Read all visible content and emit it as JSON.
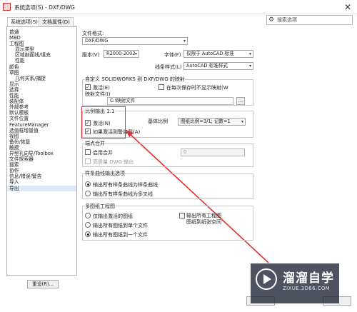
{
  "window": {
    "title": "系统选项(S) - DXF/DWG",
    "close": "✕"
  },
  "tabs": [
    {
      "label": "系统选项(S)"
    },
    {
      "label": "文档属性(D)"
    }
  ],
  "search": {
    "placeholder": "搜索选项"
  },
  "tree": {
    "items": [
      "普通",
      "MBD",
      "工程图",
      "显示类型",
      "区域剖面线/填充",
      "性能",
      "颜色",
      "草图",
      "几何关系/捕捉",
      "显示",
      "选择",
      "性能",
      "装配体",
      "外部参考",
      "默认模板",
      "文件位置",
      "FeatureManager",
      "选值框增量值",
      "视图",
      "备份/恢复",
      "触摸",
      "异型孔向导/Toolbox",
      "文件探索器",
      "搜索",
      "协作",
      "信息/错误/警告",
      "导入",
      "导出"
    ]
  },
  "reset_button": "重设(R)...",
  "file_format": {
    "label": "文件格式:",
    "value": "DXF/DWG"
  },
  "version": {
    "label": "版本(V)",
    "value": "R2000-2002"
  },
  "font": {
    "label": "字体(F)",
    "value": "仅限于 AutoCAD 标准"
  },
  "line_style": {
    "label": "线条样式(L)",
    "value": "AutoCAD 标准样式"
  },
  "custom_map": {
    "title": "自定义 SOLIDWORKS 到 DXF/DWG 的映射",
    "enable": "激活(E)",
    "no_show": "在每次保存时不显示映射(W",
    "map_file_label": "映射文件(I)",
    "map_file_value": "C:\\映射文件",
    "browse": "..."
  },
  "scale": {
    "title": "比例输出 1:1",
    "enable": "激活(N)",
    "base_scale_label": "基体比例",
    "base_scale_value": "图纸比例=3/1; 记数=1",
    "warn": "如果激活则警告我(A)"
  },
  "endpoint_merge": {
    "title": "端点合并",
    "enable": "启用合并",
    "tolerance_value": "0",
    "hq_output": "高质量 DWG 输出"
  },
  "spline": {
    "title": "样条曲线输出选项",
    "opt1": "输出所有样条曲线为样条曲线",
    "opt2": "输出所有样条曲线为多叉线"
  },
  "multi_sheet": {
    "title": "多图纸工程图",
    "opt1": "仅输出激活的图纸",
    "opt2": "输出所有图纸到单个文件",
    "opt3": "输出所有图纸到一个文件",
    "export_all_line1": "输出所有工程图",
    "export_all_line2": "图纸到纸张空间"
  },
  "watermark": {
    "title": "溜溜自学",
    "url": "ZIXUE.3D66.COM"
  },
  "colors": {
    "annotation_red": "#e03030",
    "selection": "#dde9f7"
  }
}
